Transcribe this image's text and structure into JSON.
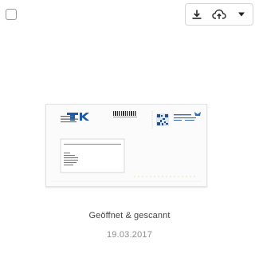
{
  "document": {
    "title": "Geöffnet & gescannt",
    "date": "19.03.2017"
  },
  "toolbar": {
    "download_icon": "download-icon",
    "upload_icon": "cloud-upload-icon",
    "menu_icon": "caret-down-icon"
  },
  "colors": {
    "tk_blue": "#1f5aa6",
    "border": "#d6d6d6",
    "title_text": "#444444",
    "date_text": "#8c8c8c"
  }
}
